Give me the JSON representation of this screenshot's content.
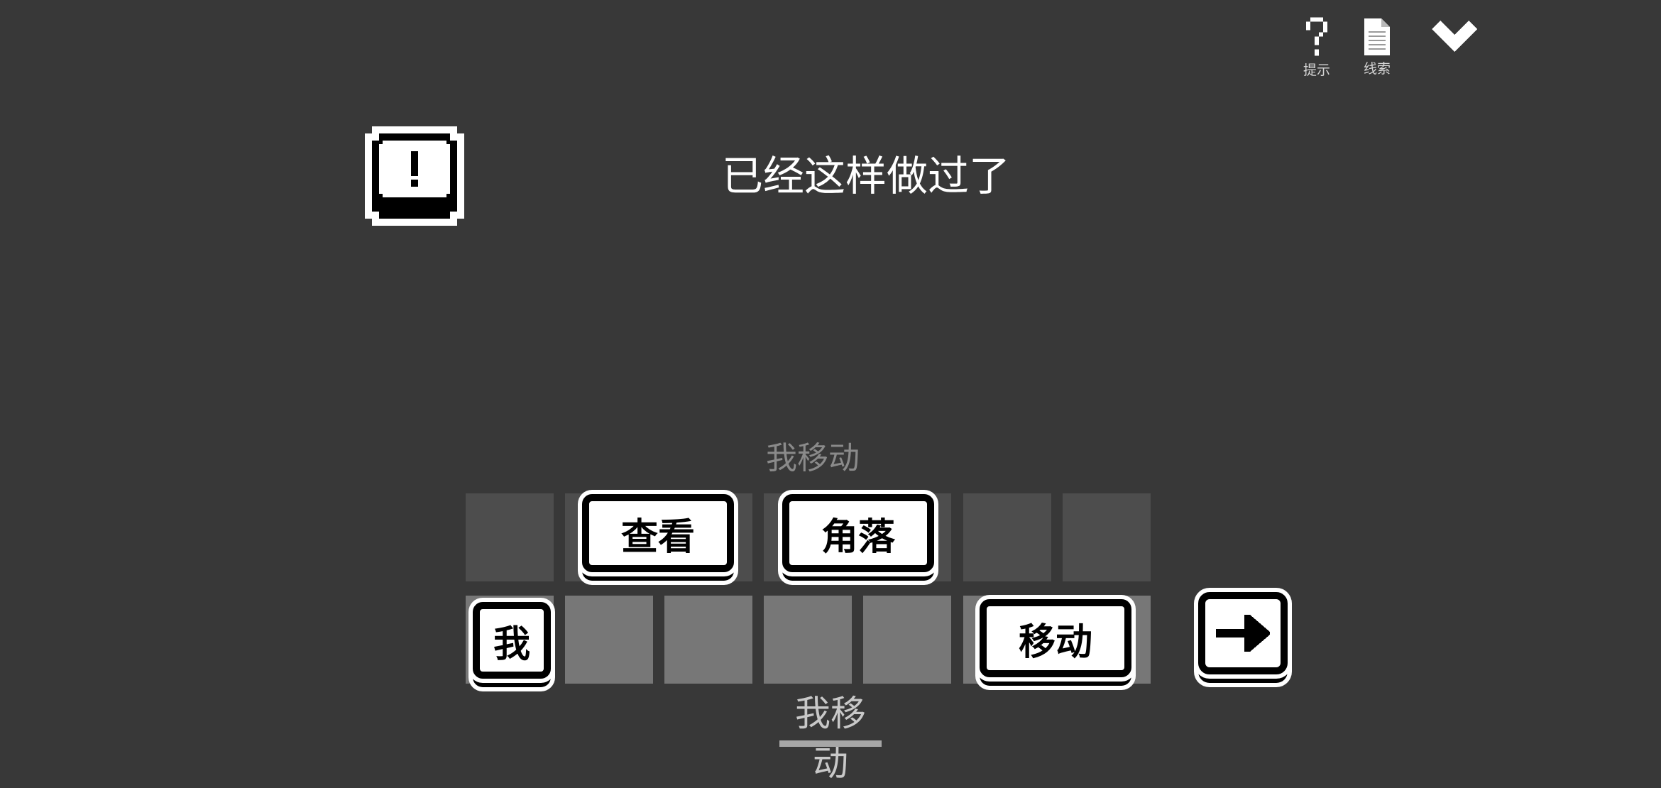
{
  "toolbar": {
    "hint_label": "提示",
    "clue_label": "线索",
    "hint_icon": "question-mark-icon",
    "clue_icon": "document-icon",
    "collapse_icon": "chevron-down-icon"
  },
  "alert": {
    "icon": "exclamation-icon",
    "symbol": "!"
  },
  "message": "已经这样做过了",
  "sentence_preview": "我移动",
  "tiles": {
    "look": "查看",
    "corner": "角落",
    "me": "我",
    "move": "移动"
  },
  "submit": {
    "icon": "arrow-right-icon"
  },
  "sentence_current": "我移动",
  "colors": {
    "background": "#383838",
    "slot_top": "#4d4d4d",
    "slot_bottom": "#777777",
    "tile_fill": "#ffffff",
    "tile_border": "#000000"
  }
}
